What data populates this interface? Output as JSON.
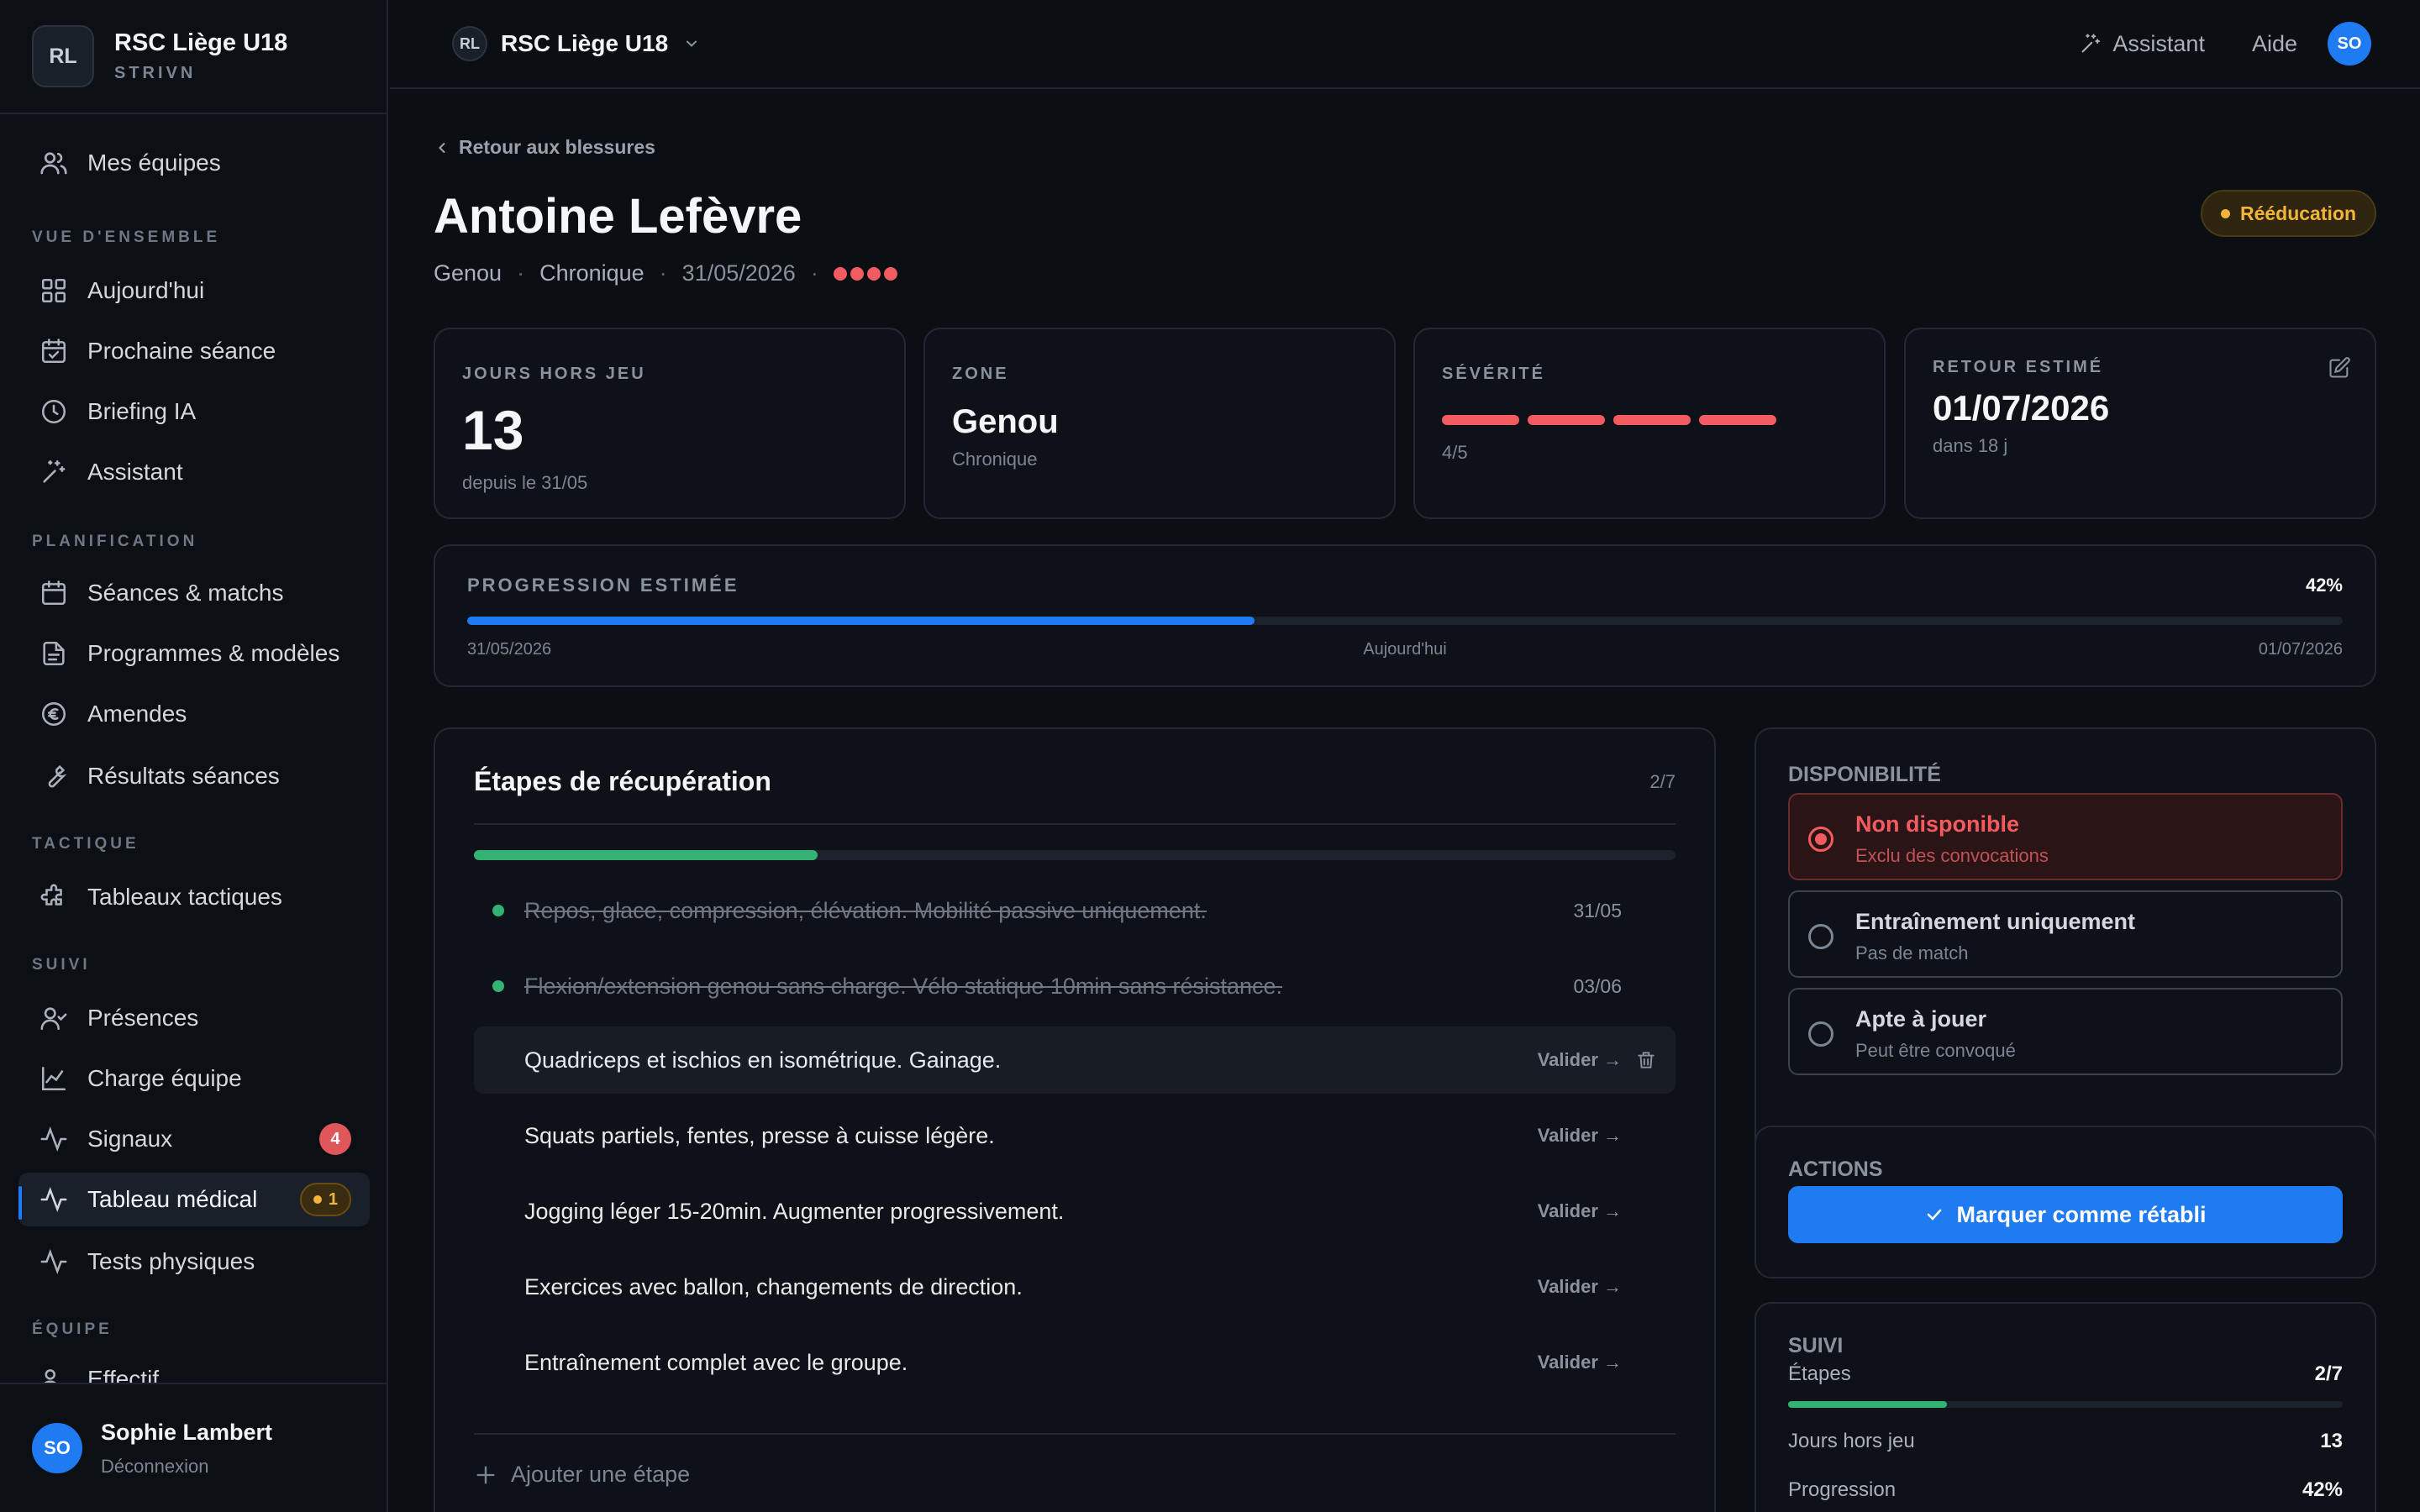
{
  "sidebar": {
    "logo": "RL",
    "club_name": "RSC Liège U18",
    "club_sub": "STRIVN",
    "my_teams": "Mes équipes",
    "sections": {
      "overview": "VUE D'ENSEMBLE",
      "planning": "PLANIFICATION",
      "tactics": "TACTIQUE",
      "tracking": "SUIVI",
      "team": "ÉQUIPE"
    },
    "items": {
      "today": "Aujourd'hui",
      "next_session": "Prochaine séance",
      "briefing": "Briefing IA",
      "assistant": "Assistant",
      "sessions": "Séances & matchs",
      "programs": "Programmes & modèles",
      "fines": "Amendes",
      "results": "Résultats séances",
      "tactics_boards": "Tableaux tactiques",
      "attendance": "Présences",
      "team_load": "Charge équipe",
      "signals": "Signaux",
      "signals_badge": "4",
      "medical": "Tableau médical",
      "medical_badge": "1",
      "physical_tests": "Tests physiques",
      "roster": "Effectif"
    },
    "user": {
      "initials": "SO",
      "name": "Sophie Lambert",
      "logout": "Déconnexion"
    }
  },
  "topbar": {
    "team_chip": "RL",
    "team_name": "RSC Liège U18",
    "assistant": "Assistant",
    "help": "Aide",
    "avatar": "SO"
  },
  "injury": {
    "back": "Retour aux blessures",
    "player": "Antoine Lefèvre",
    "zone": "Genou",
    "type": "Chronique",
    "date": "31/05/2026",
    "severity_dots": 4,
    "status": "Rééducation"
  },
  "stats": {
    "days_out": {
      "label": "JOURS HORS JEU",
      "value": "13",
      "sub": "depuis le 31/05"
    },
    "zone": {
      "label": "ZONE",
      "value": "Genou",
      "sub": "Chronique"
    },
    "severity": {
      "label": "SÉVÉRITÉ",
      "value": 4,
      "sub": "4/5"
    },
    "return": {
      "label": "RETOUR ESTIMÉ",
      "value": "01/07/2026",
      "sub": "dans 18 j"
    }
  },
  "progress": {
    "label": "PROGRESSION ESTIMÉE",
    "percent_text": "42%",
    "percent": 42,
    "start": "31/05/2026",
    "today": "Aujourd'hui",
    "end": "01/07/2026"
  },
  "steps": {
    "title": "Étapes de récupération",
    "count": "2/7",
    "done_fraction": 0.2857,
    "validate_label": "Valider →",
    "add_label": "Ajouter une étape",
    "items": [
      {
        "text": "Repos, glace, compression, élévation. Mobilité passive uniquement.",
        "date": "31/05"
      },
      {
        "text": "Flexion/extension genou sans charge. Vélo statique 10min sans résistance.",
        "date": "03/06"
      },
      {
        "text": "Quadriceps et ischios en isométrique. Gainage."
      },
      {
        "text": "Squats partiels, fentes, presse à cuisse légère."
      },
      {
        "text": "Jogging léger 15-20min. Augmenter progressivement."
      },
      {
        "text": "Exercices avec ballon, changements de direction."
      },
      {
        "text": "Entraînement complet avec le groupe."
      }
    ]
  },
  "availability": {
    "title": "DISPONIBILITÉ",
    "options": [
      {
        "title": "Non disponible",
        "sub": "Exclu des convocations"
      },
      {
        "title": "Entraînement uniquement",
        "sub": "Pas de match"
      },
      {
        "title": "Apte à jouer",
        "sub": "Peut être convoqué"
      }
    ]
  },
  "actions": {
    "title": "ACTIONS",
    "mark_recovered": "Marquer comme rétabli"
  },
  "suivi": {
    "title": "SUIVI",
    "steps_label": "Étapes",
    "steps_value": "2/7",
    "steps_fraction": 0.2857,
    "days_label": "Jours hors jeu",
    "days_value": "13",
    "progress_label": "Progression",
    "progress_value": "42%"
  },
  "colors": {
    "accent": "#1e7bf2",
    "danger": "#f25c61",
    "success": "#32b273",
    "warning": "#f2b53a"
  }
}
